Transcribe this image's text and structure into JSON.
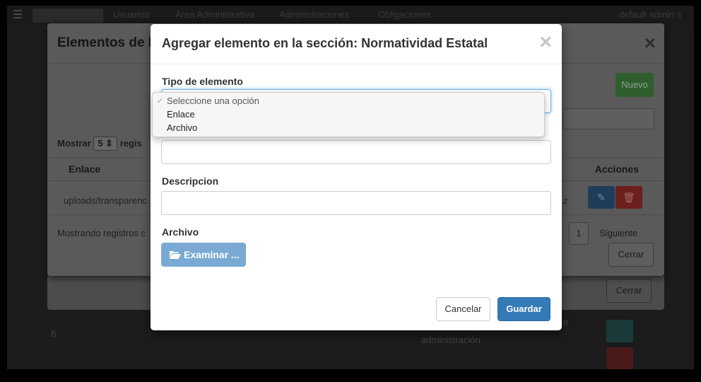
{
  "navbar": {
    "items": [
      "Usuarios",
      "Área Administrativa",
      "Administraciones",
      "Obligaciones"
    ],
    "user": "default admin s"
  },
  "background": {
    "row_number": "8",
    "row_text": "administración",
    "row_prefix": "e",
    "cerrar_label": "Cerrar"
  },
  "back_modal": {
    "title": "Elementos de la",
    "nuevo_label": "Nuevo",
    "mostrar_label": "Mostrar",
    "mostrar_value": "5",
    "mostrar_suffix": "regis",
    "col_enlace": "Enlace",
    "col_acciones": "Acciones",
    "row_enlace": "uploads/transparenc",
    "row_z": "z",
    "mostrando": "Mostrando registros c",
    "page": "1",
    "siguiente": "Siguiente",
    "cerrar_label": "Cerrar"
  },
  "modal": {
    "title": "Agregar elemento en la sección: Normatividad Estatal",
    "close_symbol": "×",
    "tipo_label": "Tipo de elemento",
    "tipo_options": [
      "Seleccione una opción",
      "Enlace",
      "Archivo"
    ],
    "tipo_selected": "Seleccione una opción",
    "nombre_value": "",
    "descripcion_label": "Descripcion",
    "descripcion_value": "",
    "archivo_label": "Archivo",
    "examinar_label": "Examinar ...",
    "cancelar_label": "Cancelar",
    "guardar_label": "Guardar"
  },
  "colors": {
    "primary": "#337ab7",
    "examinar": "#7aaad4",
    "focus": "#66afe9",
    "success_dim": "#2f5f2f",
    "danger_dim": "#6d1f1d"
  }
}
